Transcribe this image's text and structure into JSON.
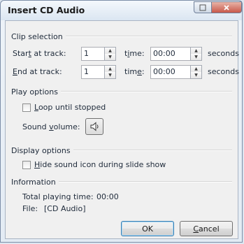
{
  "dialog": {
    "title": "Insert CD Audio",
    "help_icon": "help-icon",
    "close_icon": "close-icon"
  },
  "clip_selection": {
    "section_label": "Clip selection",
    "start": {
      "label_pre": "Star",
      "label_u": "t",
      "label_post": " at track:",
      "track": "1",
      "time_label_pre": "t",
      "time_label_u": "i",
      "time_label_post": "me:",
      "time": "00:00",
      "unit": "seconds"
    },
    "end": {
      "label_pre": "",
      "label_u": "E",
      "label_post": "nd at track:",
      "track": "1",
      "time_label_pre": "tim",
      "time_label_u": "e",
      "time_label_post": ":",
      "time": "00:00",
      "unit": "seconds"
    }
  },
  "play_options": {
    "section_label": "Play options",
    "loop": {
      "label_u": "L",
      "label_post": "oop until stopped",
      "checked": false
    },
    "sound_volume": {
      "label_pre": "Sound ",
      "label_u": "v",
      "label_post": "olume:",
      "icon": "speaker-icon"
    }
  },
  "display_options": {
    "section_label": "Display options",
    "hide_icon": {
      "label_u": "H",
      "label_post": "ide sound icon during slide show",
      "checked": false
    }
  },
  "information": {
    "section_label": "Information",
    "total_playing_time_label": "Total playing time:",
    "total_playing_time": "00:00",
    "file_label": "File:",
    "file": "[CD Audio]"
  },
  "buttons": {
    "ok": "OK",
    "cancel_u": "C",
    "cancel_post": "ancel"
  }
}
